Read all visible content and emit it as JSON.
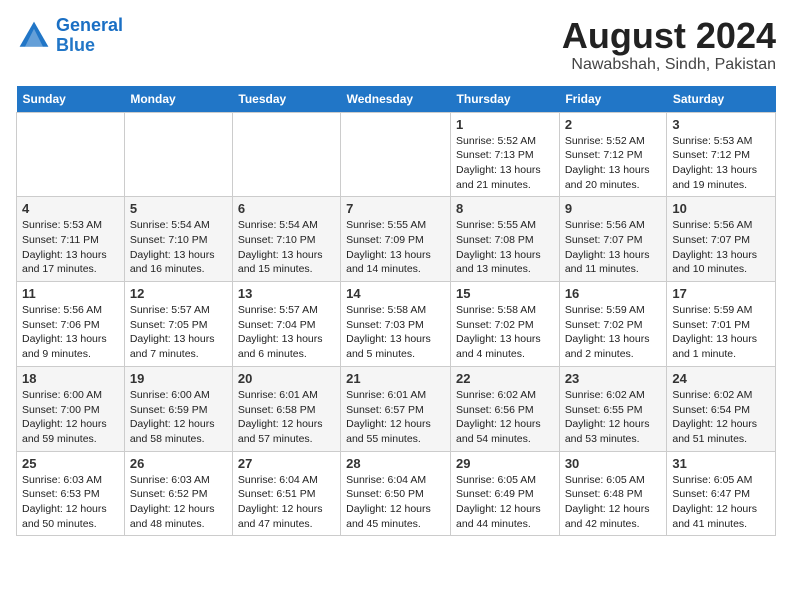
{
  "header": {
    "logo_line1": "General",
    "logo_line2": "Blue",
    "month_year": "August 2024",
    "location": "Nawabshah, Sindh, Pakistan"
  },
  "weekdays": [
    "Sunday",
    "Monday",
    "Tuesday",
    "Wednesday",
    "Thursday",
    "Friday",
    "Saturday"
  ],
  "weeks": [
    [
      {
        "day": "",
        "info": ""
      },
      {
        "day": "",
        "info": ""
      },
      {
        "day": "",
        "info": ""
      },
      {
        "day": "",
        "info": ""
      },
      {
        "day": "1",
        "info": "Sunrise: 5:52 AM\nSunset: 7:13 PM\nDaylight: 13 hours\nand 21 minutes."
      },
      {
        "day": "2",
        "info": "Sunrise: 5:52 AM\nSunset: 7:12 PM\nDaylight: 13 hours\nand 20 minutes."
      },
      {
        "day": "3",
        "info": "Sunrise: 5:53 AM\nSunset: 7:12 PM\nDaylight: 13 hours\nand 19 minutes."
      }
    ],
    [
      {
        "day": "4",
        "info": "Sunrise: 5:53 AM\nSunset: 7:11 PM\nDaylight: 13 hours\nand 17 minutes."
      },
      {
        "day": "5",
        "info": "Sunrise: 5:54 AM\nSunset: 7:10 PM\nDaylight: 13 hours\nand 16 minutes."
      },
      {
        "day": "6",
        "info": "Sunrise: 5:54 AM\nSunset: 7:10 PM\nDaylight: 13 hours\nand 15 minutes."
      },
      {
        "day": "7",
        "info": "Sunrise: 5:55 AM\nSunset: 7:09 PM\nDaylight: 13 hours\nand 14 minutes."
      },
      {
        "day": "8",
        "info": "Sunrise: 5:55 AM\nSunset: 7:08 PM\nDaylight: 13 hours\nand 13 minutes."
      },
      {
        "day": "9",
        "info": "Sunrise: 5:56 AM\nSunset: 7:07 PM\nDaylight: 13 hours\nand 11 minutes."
      },
      {
        "day": "10",
        "info": "Sunrise: 5:56 AM\nSunset: 7:07 PM\nDaylight: 13 hours\nand 10 minutes."
      }
    ],
    [
      {
        "day": "11",
        "info": "Sunrise: 5:56 AM\nSunset: 7:06 PM\nDaylight: 13 hours\nand 9 minutes."
      },
      {
        "day": "12",
        "info": "Sunrise: 5:57 AM\nSunset: 7:05 PM\nDaylight: 13 hours\nand 7 minutes."
      },
      {
        "day": "13",
        "info": "Sunrise: 5:57 AM\nSunset: 7:04 PM\nDaylight: 13 hours\nand 6 minutes."
      },
      {
        "day": "14",
        "info": "Sunrise: 5:58 AM\nSunset: 7:03 PM\nDaylight: 13 hours\nand 5 minutes."
      },
      {
        "day": "15",
        "info": "Sunrise: 5:58 AM\nSunset: 7:02 PM\nDaylight: 13 hours\nand 4 minutes."
      },
      {
        "day": "16",
        "info": "Sunrise: 5:59 AM\nSunset: 7:02 PM\nDaylight: 13 hours\nand 2 minutes."
      },
      {
        "day": "17",
        "info": "Sunrise: 5:59 AM\nSunset: 7:01 PM\nDaylight: 13 hours\nand 1 minute."
      }
    ],
    [
      {
        "day": "18",
        "info": "Sunrise: 6:00 AM\nSunset: 7:00 PM\nDaylight: 12 hours\nand 59 minutes."
      },
      {
        "day": "19",
        "info": "Sunrise: 6:00 AM\nSunset: 6:59 PM\nDaylight: 12 hours\nand 58 minutes."
      },
      {
        "day": "20",
        "info": "Sunrise: 6:01 AM\nSunset: 6:58 PM\nDaylight: 12 hours\nand 57 minutes."
      },
      {
        "day": "21",
        "info": "Sunrise: 6:01 AM\nSunset: 6:57 PM\nDaylight: 12 hours\nand 55 minutes."
      },
      {
        "day": "22",
        "info": "Sunrise: 6:02 AM\nSunset: 6:56 PM\nDaylight: 12 hours\nand 54 minutes."
      },
      {
        "day": "23",
        "info": "Sunrise: 6:02 AM\nSunset: 6:55 PM\nDaylight: 12 hours\nand 53 minutes."
      },
      {
        "day": "24",
        "info": "Sunrise: 6:02 AM\nSunset: 6:54 PM\nDaylight: 12 hours\nand 51 minutes."
      }
    ],
    [
      {
        "day": "25",
        "info": "Sunrise: 6:03 AM\nSunset: 6:53 PM\nDaylight: 12 hours\nand 50 minutes."
      },
      {
        "day": "26",
        "info": "Sunrise: 6:03 AM\nSunset: 6:52 PM\nDaylight: 12 hours\nand 48 minutes."
      },
      {
        "day": "27",
        "info": "Sunrise: 6:04 AM\nSunset: 6:51 PM\nDaylight: 12 hours\nand 47 minutes."
      },
      {
        "day": "28",
        "info": "Sunrise: 6:04 AM\nSunset: 6:50 PM\nDaylight: 12 hours\nand 45 minutes."
      },
      {
        "day": "29",
        "info": "Sunrise: 6:05 AM\nSunset: 6:49 PM\nDaylight: 12 hours\nand 44 minutes."
      },
      {
        "day": "30",
        "info": "Sunrise: 6:05 AM\nSunset: 6:48 PM\nDaylight: 12 hours\nand 42 minutes."
      },
      {
        "day": "31",
        "info": "Sunrise: 6:05 AM\nSunset: 6:47 PM\nDaylight: 12 hours\nand 41 minutes."
      }
    ]
  ]
}
